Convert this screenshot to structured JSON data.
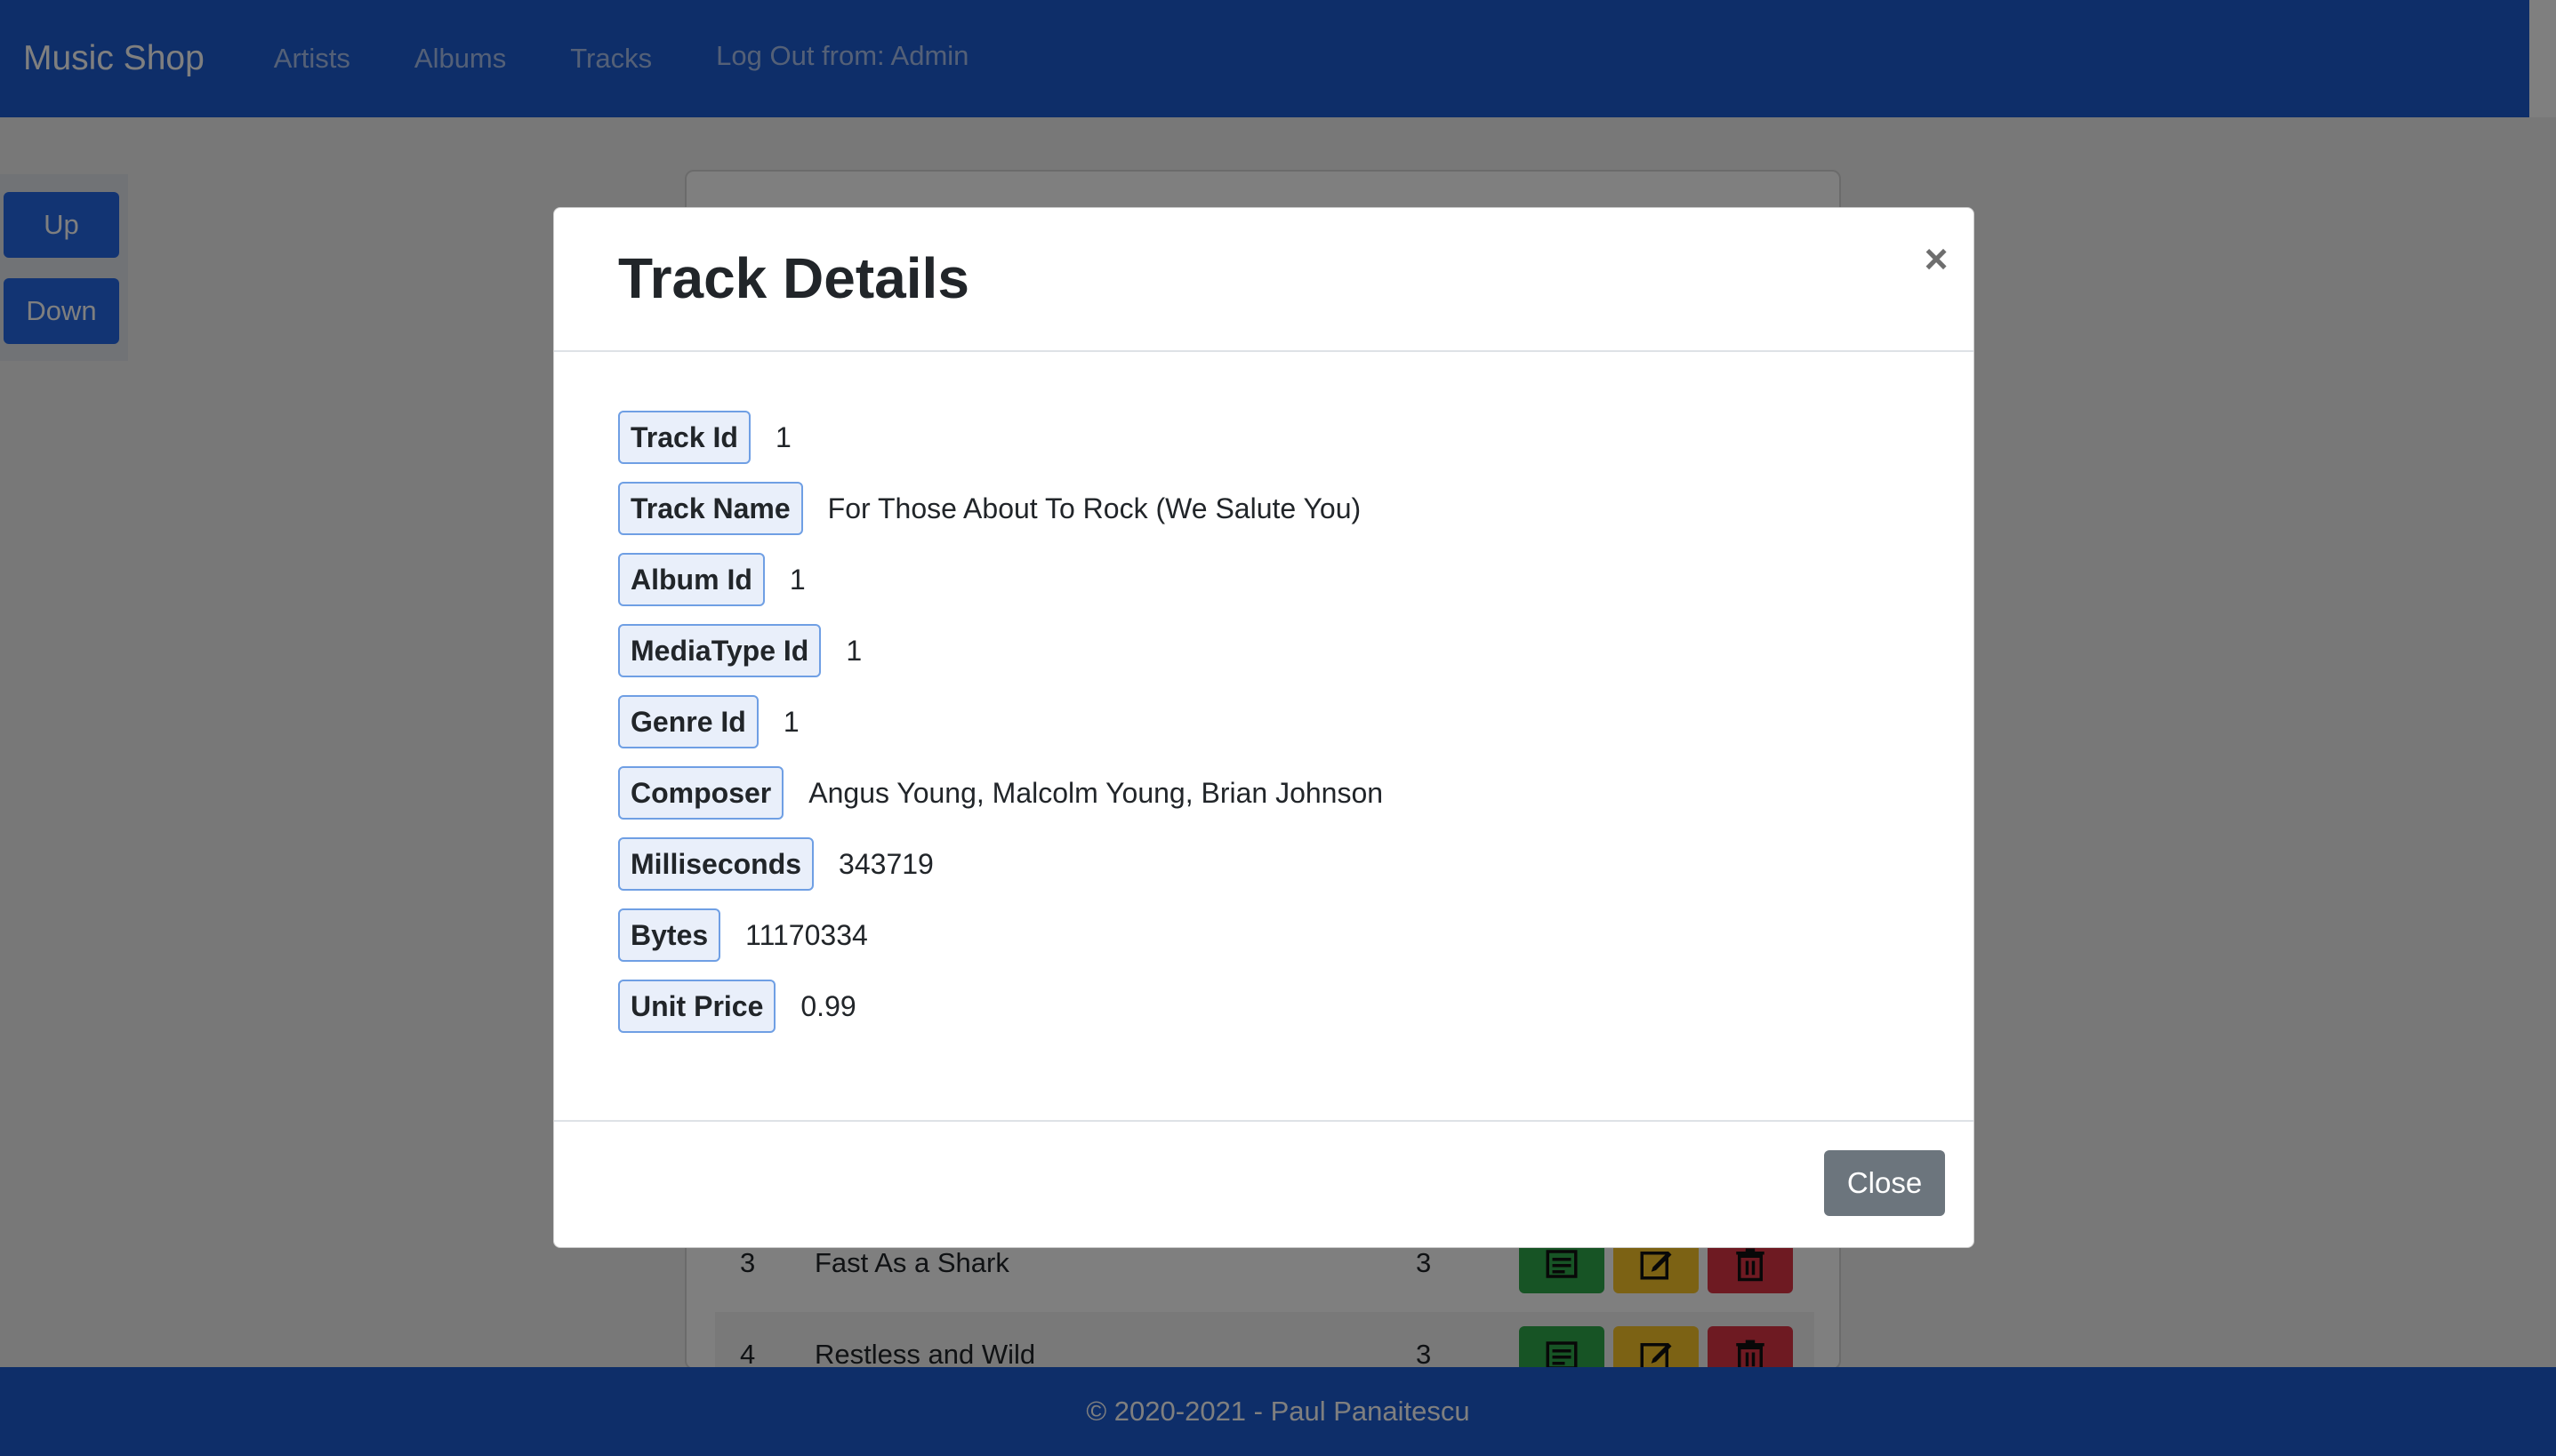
{
  "navbar": {
    "brand": "Music Shop",
    "links": [
      "Artists",
      "Albums",
      "Tracks"
    ],
    "logout": "Log Out from: Admin"
  },
  "side": {
    "up": "Up",
    "down": "Down"
  },
  "background_rows": [
    {
      "id": "3",
      "name": "Fast As a Shark",
      "num": "3"
    },
    {
      "id": "4",
      "name": "Restless and Wild",
      "num": "3"
    }
  ],
  "footer": {
    "text": "© 2020-2021 - Paul Panaitescu"
  },
  "modal": {
    "title": "Track Details",
    "close_x": "×",
    "fields": [
      {
        "label": "Track Id",
        "value": "1"
      },
      {
        "label": "Track Name",
        "value": "For Those About To Rock (We Salute You)"
      },
      {
        "label": "Album Id",
        "value": "1"
      },
      {
        "label": "MediaType Id",
        "value": "1"
      },
      {
        "label": "Genre Id",
        "value": "1"
      },
      {
        "label": "Composer",
        "value": "Angus Young, Malcolm Young, Brian Johnson"
      },
      {
        "label": "Milliseconds",
        "value": "343719"
      },
      {
        "label": "Bytes",
        "value": "11170334"
      },
      {
        "label": "Unit Price",
        "value": "0.99"
      }
    ],
    "close_button": "Close"
  },
  "colors": {
    "primary": "#1c5dd3",
    "success": "#2fa84a",
    "warning": "#f8c429",
    "danger": "#dc3545",
    "secondary": "#6c757d"
  },
  "icons": {
    "view": "list-icon",
    "edit": "edit-icon",
    "delete": "trash-icon"
  }
}
